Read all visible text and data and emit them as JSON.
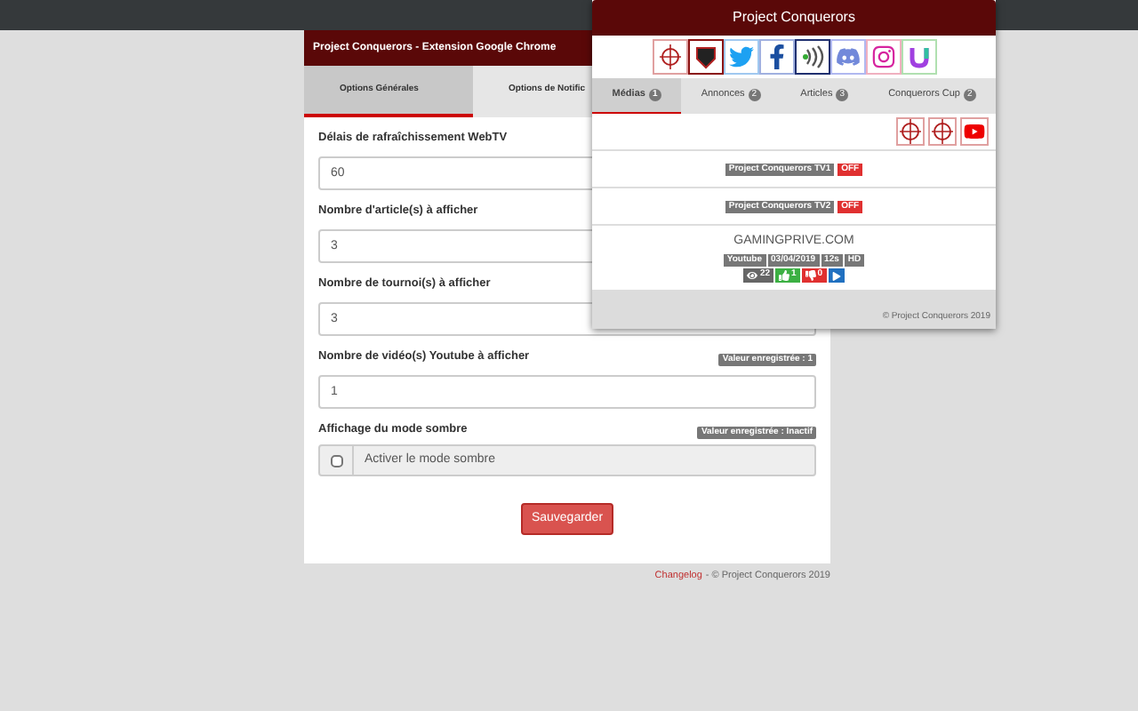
{
  "card": {
    "title": "Project Conquerors - Extension Google Chrome",
    "tabs": [
      {
        "label": "Options Générales",
        "selected": true
      },
      {
        "label": "Options de Notific",
        "selected": false
      }
    ],
    "fields": [
      {
        "label": "Délais de rafraîchissement WebTV",
        "value": "60"
      },
      {
        "label": "Nombre d'article(s) à afficher",
        "value": "3"
      },
      {
        "label": "Nombre de tournoi(s) à afficher",
        "value": "3"
      },
      {
        "label": "Nombre de vidéo(s) Youtube à afficher",
        "value": "1",
        "badge": "Valeur enregistrée : 1"
      }
    ],
    "dark_mode": {
      "label": "Affichage du mode sombre",
      "badge": "Valeur enregistrée : Inactif",
      "checkbox_label": "Activer le mode sombre",
      "checked": false
    },
    "save_button": "Sauvegarder"
  },
  "footer": {
    "link": "Changelog",
    "text": "- © Project Conquerors 2019"
  },
  "popup": {
    "title": "Project Conquerors",
    "tabs": [
      {
        "label": "Médias",
        "count": "1",
        "selected": true
      },
      {
        "label": "Annonces",
        "count": "2",
        "selected": false
      },
      {
        "label": "Articles",
        "count": "3",
        "selected": false
      },
      {
        "label": "Conquerors Cup",
        "count": "2",
        "selected": false
      }
    ],
    "streams": [
      {
        "name": "Project Conquerors TV1",
        "status": "OFF"
      },
      {
        "name": "Project Conquerors TV2",
        "status": "OFF"
      }
    ],
    "video": {
      "channel": "GAMINGPRIVE.COM",
      "tags": [
        "Youtube",
        "03/04/2019",
        "12s",
        "HD"
      ],
      "stats": [
        {
          "kind": "views",
          "value": "22"
        },
        {
          "kind": "likes",
          "value": "1"
        },
        {
          "kind": "dislikes",
          "value": "0"
        },
        {
          "kind": "play"
        }
      ]
    },
    "footer": "© Project Conquerors 2019"
  }
}
